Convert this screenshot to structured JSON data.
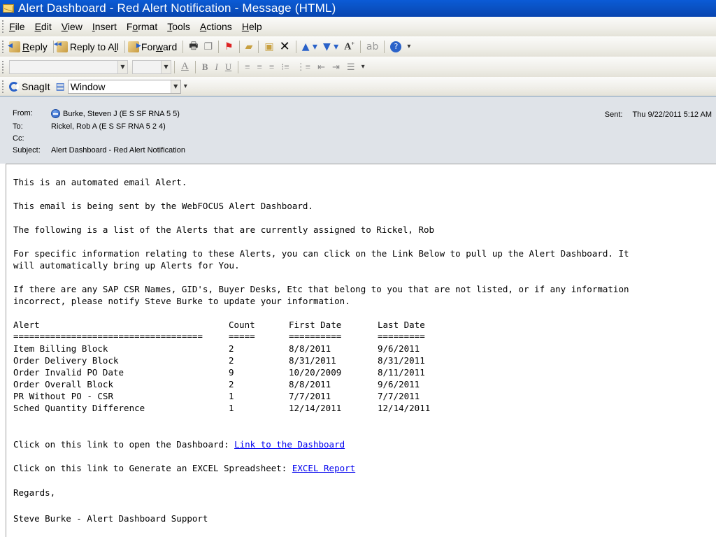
{
  "window": {
    "title": "Alert Dashboard - Red Alert Notification - Message (HTML)"
  },
  "menu": [
    {
      "label": "File",
      "accel": "F",
      "rest": "ile"
    },
    {
      "label": "Edit",
      "accel": "E",
      "rest": "dit"
    },
    {
      "label": "View",
      "accel": "V",
      "rest": "iew"
    },
    {
      "label": "Insert",
      "accel": "I",
      "rest": "nsert"
    },
    {
      "label": "Format",
      "pre": "F",
      "accel": "o",
      "rest": "rmat"
    },
    {
      "label": "Tools",
      "accel": "T",
      "rest": "ools"
    },
    {
      "label": "Actions",
      "accel": "A",
      "rest": "ctions"
    },
    {
      "label": "Help",
      "accel": "H",
      "rest": "elp"
    }
  ],
  "toolbar1": {
    "reply": {
      "accel": "R",
      "rest": "eply"
    },
    "reply_all": {
      "pre": "Reply to A",
      "accel": "l",
      "rest": "l"
    },
    "forward": {
      "pre": "For",
      "accel": "w",
      "rest": "ard"
    }
  },
  "toolbar3": {
    "snagit_label": "SnagIt",
    "window_select": "Window"
  },
  "header": {
    "from_label": "From:",
    "from_value": "Burke, Steven J (E S SF RNA 5 5)",
    "to_label": "To:",
    "to_value": "Rickel, Rob A (E S SF RNA 5 2 4)",
    "cc_label": "Cc:",
    "cc_value": "",
    "subject_label": "Subject:",
    "subject_value": "Alert Dashboard - Red Alert Notification",
    "sent_label": "Sent:",
    "sent_value": "Thu 9/22/2011 5:12 AM"
  },
  "body": {
    "p1": "This is an automated email Alert.",
    "p2": "This email is being sent by the WebFOCUS Alert Dashboard.",
    "p3": "The following is a list of the Alerts that are currently assigned to Rickel, Rob",
    "p4a": "For specific information relating to these Alerts, you can click on the Link Below to pull up the Alert Dashboard. It",
    "p4b": "will automatically bring up Alerts for You.",
    "p5a": "If there are any SAP CSR Names, GID's, Buyer Desks, Etc that belong to you that are not listed, or if any information",
    "p5b": "incorrect, please notify Steve Burke to update your information.",
    "table": {
      "headers": [
        "Alert",
        "Count",
        "First Date",
        "Last Date"
      ],
      "underlines": [
        "====================================",
        "=====",
        "==========",
        "========="
      ],
      "rows": [
        [
          "Item Billing Block",
          "2",
          "8/8/2011",
          "9/6/2011"
        ],
        [
          "Order Delivery Block",
          "2",
          "8/31/2011",
          "8/31/2011"
        ],
        [
          "Order Invalid PO Date",
          "9",
          "10/20/2009",
          "8/11/2011"
        ],
        [
          "Order Overall Block",
          "2",
          "8/8/2011",
          "9/6/2011"
        ],
        [
          "PR Without PO - CSR",
          "1",
          "7/7/2011",
          "7/7/2011"
        ],
        [
          "Sched Quantity Difference",
          "1",
          "12/14/2011",
          "12/14/2011"
        ]
      ]
    },
    "link1_prefix": "Click on this link to open the Dashboard: ",
    "link1_text": "Link to the Dashboard",
    "link2_prefix": "Click on this link to Generate an EXCEL Spreadsheet: ",
    "link2_text": "EXCEL Report",
    "regards": "Regards,",
    "signature": "Steve Burke - Alert Dashboard Support"
  }
}
